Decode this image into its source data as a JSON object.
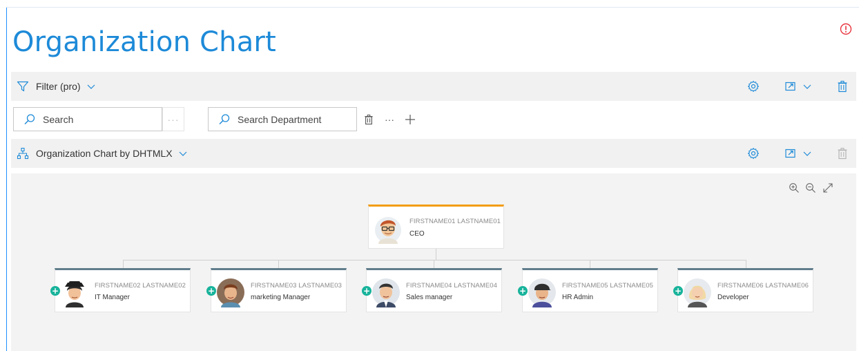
{
  "page": {
    "title": "Organization Chart"
  },
  "filter_bar": {
    "label": "Filter (pro)"
  },
  "search": {
    "placeholder": "Search",
    "department_placeholder": "Search Department",
    "more_label": "···"
  },
  "chart_bar": {
    "label": "Organization Chart by DHTMLX"
  },
  "colors": {
    "accent": "#1d8ad8",
    "root_border": "#f39c12",
    "child_border": "#607d8b",
    "add_badge": "#18b39b",
    "alert": "#e8323c"
  },
  "org": {
    "root": {
      "name": "FIRSTNAME01 LASTNAME01",
      "role": "CEO"
    },
    "children": [
      {
        "name": "FIRSTNAME02 LASTNAME02",
        "role": "IT Manager"
      },
      {
        "name": "FIRSTNAME03 LASTNAME03",
        "role": "marketing Manager"
      },
      {
        "name": "FIRSTNAME04 LASTNAME04",
        "role": "Sales manager"
      },
      {
        "name": "FIRSTNAME05 LASTNAME05",
        "role": "HR Admin"
      },
      {
        "name": "FIRSTNAME06 LASTNAME06",
        "role": "Developer"
      }
    ]
  },
  "icons": [
    "alert-icon",
    "filter-icon",
    "chevron-down-icon",
    "gear-icon",
    "export-icon",
    "trash-icon",
    "search-icon",
    "plus-icon",
    "org-chart-icon",
    "zoom-in-icon",
    "zoom-out-icon",
    "expand-icon",
    "add-badge-icon"
  ]
}
